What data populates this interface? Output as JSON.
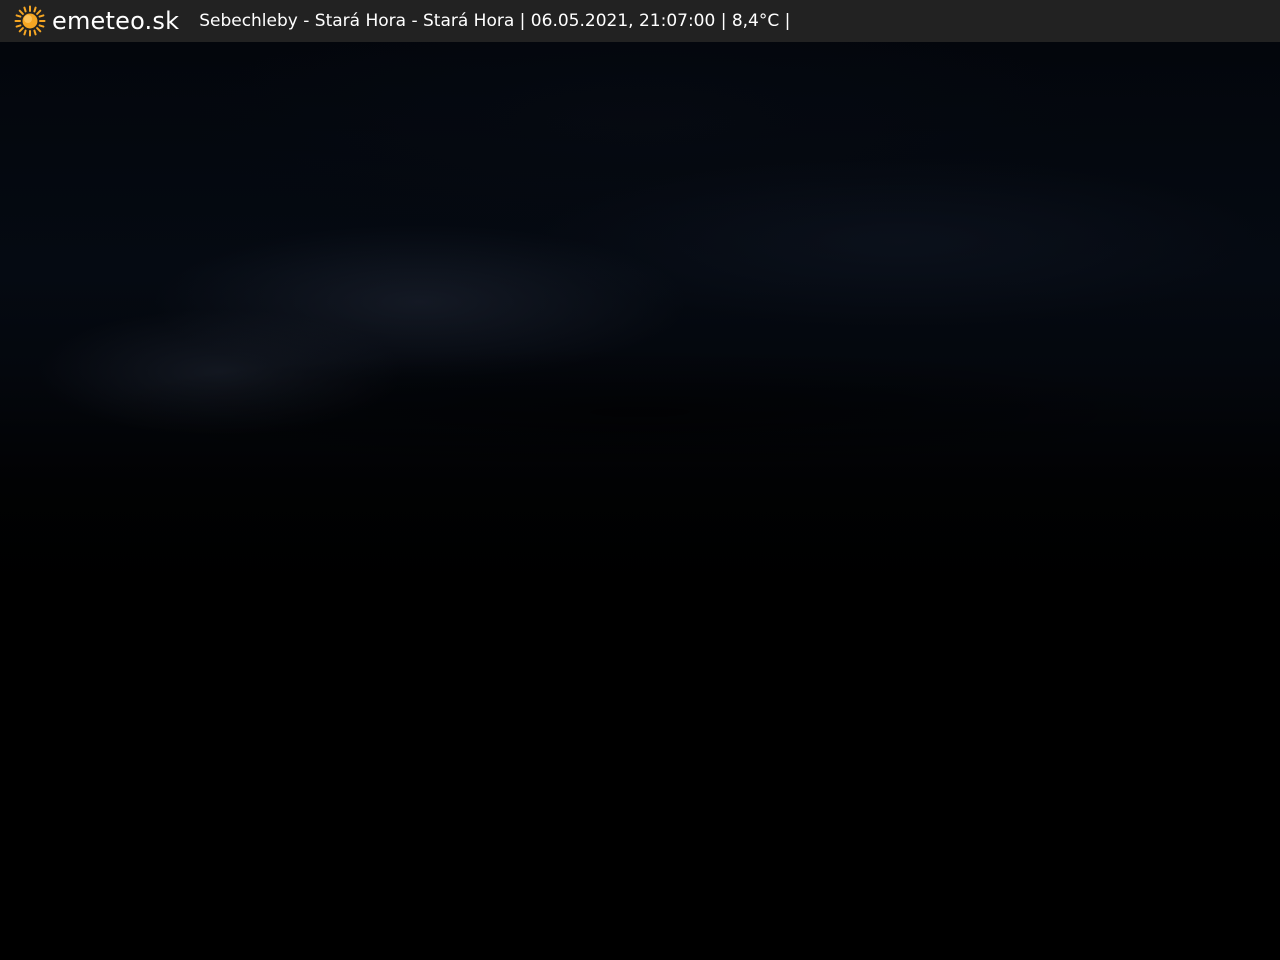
{
  "header": {
    "logo_text": "emeteo.sk",
    "logo_icon": "sun-icon",
    "caption": "Sebechleby - Stará Hora - Stará Hora | 06.05.2021, 21:07:00 | 8,4°C |"
  },
  "colors": {
    "header_background": "#222222",
    "sun_icon": "#f5a623",
    "text": "#ffffff"
  }
}
